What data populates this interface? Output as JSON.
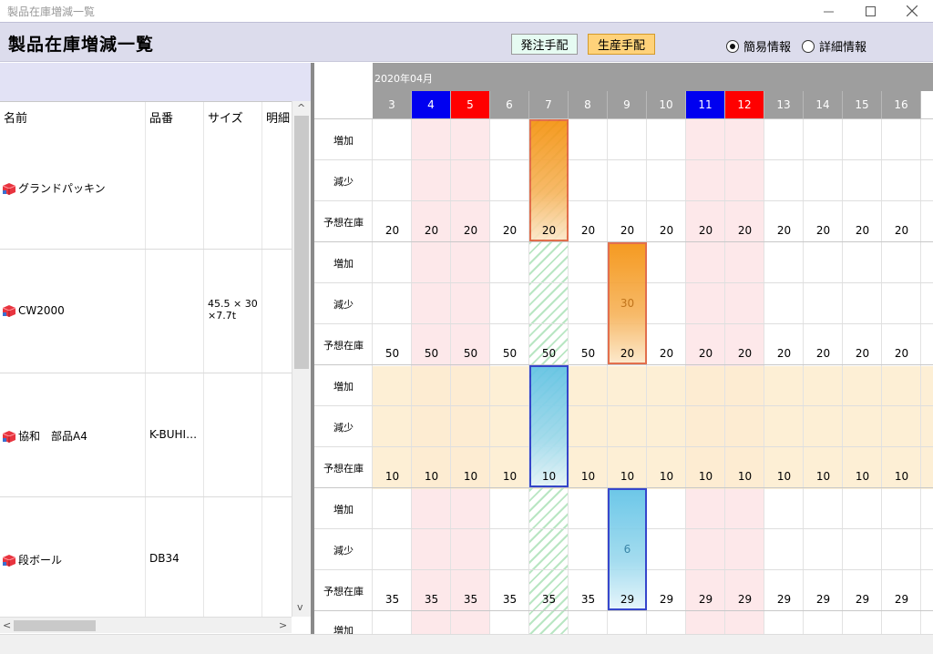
{
  "window": {
    "title": "製品在庫増減一覧"
  },
  "header": {
    "title": "製品在庫増減一覧",
    "order_btn": "発注手配",
    "produce_btn": "生産手配",
    "radio_simple": "簡易情報",
    "radio_detail": "詳細情報",
    "selected_view": "簡易情報"
  },
  "list": {
    "columns": [
      "名前",
      "品番",
      "サイズ",
      "明細"
    ],
    "items": [
      {
        "name": "グランドパッキン",
        "code": "",
        "size": ""
      },
      {
        "name": "CW2000",
        "code": "",
        "size": "45.5 × 30 ×7.7t"
      },
      {
        "name": "協和　部品A4",
        "code": "K-BUHI…",
        "size": ""
      },
      {
        "name": "段ボール",
        "code": "DB34",
        "size": ""
      }
    ]
  },
  "calendar": {
    "month": "2020年04月",
    "days": [
      "3",
      "4",
      "5",
      "6",
      "7",
      "8",
      "9",
      "10",
      "11",
      "12",
      "13",
      "14",
      "15",
      "16"
    ],
    "day_kinds": [
      "normal",
      "sat",
      "sun",
      "normal",
      "normal",
      "normal",
      "normal",
      "normal",
      "sat",
      "sun",
      "normal",
      "normal",
      "normal",
      "normal"
    ],
    "row_labels": [
      "増加",
      "減少",
      "予想在庫"
    ],
    "stock_rows": [
      [
        "20",
        "20",
        "20",
        "20",
        "20",
        "20",
        "20",
        "20",
        "20",
        "20",
        "20",
        "20",
        "20",
        "20"
      ],
      [
        "50",
        "50",
        "50",
        "50",
        "50",
        "50",
        "20",
        "20",
        "20",
        "20",
        "20",
        "20",
        "20",
        "20"
      ],
      [
        "10",
        "10",
        "10",
        "10",
        "10",
        "10",
        "10",
        "10",
        "10",
        "10",
        "10",
        "10",
        "10",
        "10"
      ],
      [
        "35",
        "35",
        "35",
        "35",
        "35",
        "35",
        "29",
        "29",
        "29",
        "29",
        "29",
        "29",
        "29",
        "29"
      ]
    ],
    "decrease_values": [
      {
        "item": 1,
        "day": "9",
        "value": "30"
      },
      {
        "item": 3,
        "day": "9",
        "value": "6"
      }
    ],
    "partial_next_label": "増加"
  },
  "colors": {
    "saturday": "#0000f0",
    "sunday": "#ff0000",
    "header_bg": "#dcdcec",
    "order_bar": "#f5900a",
    "produce_bar": "#5ec2e6"
  }
}
